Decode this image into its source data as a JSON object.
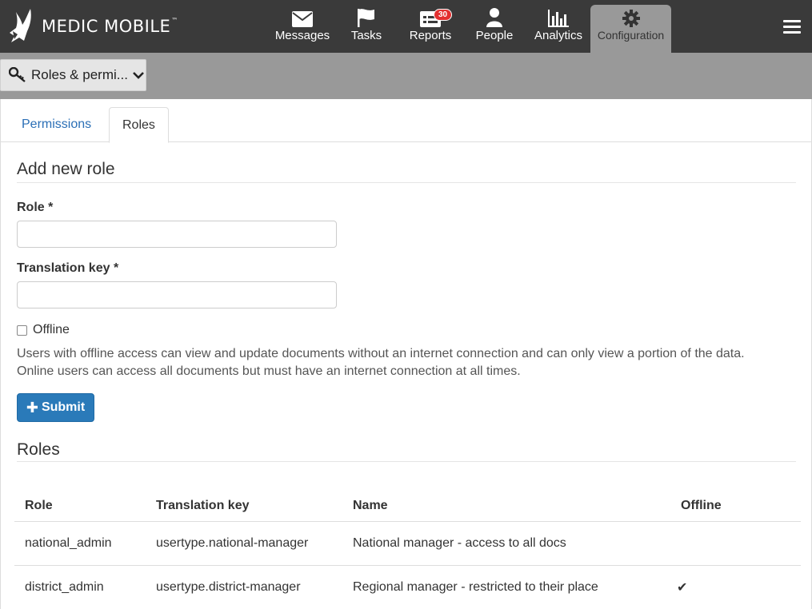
{
  "app": {
    "logo_text": "MEDIC MOBILE",
    "logo_tm": "™"
  },
  "nav": {
    "messages": "Messages",
    "tasks": "Tasks",
    "reports": "Reports",
    "reports_badge": "30",
    "people": "People",
    "analytics": "Analytics",
    "configuration": "Configuration"
  },
  "subbar": {
    "dropdown_label": "Roles & permi..."
  },
  "tabs": {
    "permissions": "Permissions",
    "roles": "Roles"
  },
  "form": {
    "title": "Add new role",
    "role_label": "Role *",
    "role_value": "",
    "translation_label": "Translation key *",
    "translation_value": "",
    "offline_label": "Offline",
    "offline_checked": false,
    "help_text_1": "Users with offline access can view and update documents without an internet connection and can only view a portion of the data.",
    "help_text_2": "Online users can access all documents but must have an internet connection at all times.",
    "submit_label": "Submit"
  },
  "roles_section": {
    "title": "Roles",
    "headers": [
      "Role",
      "Translation key",
      "Name",
      "Offline"
    ],
    "rows": [
      {
        "role": "national_admin",
        "key": "usertype.national-manager",
        "name": "National manager - access to all docs",
        "offline": ""
      },
      {
        "role": "district_admin",
        "key": "usertype.district-manager",
        "name": "Regional manager - restricted to their place",
        "offline": "✔"
      }
    ]
  },
  "colors": {
    "header_bg": "#3a3a3a",
    "subbar_bg": "#999999",
    "primary": "#2a7ab9",
    "badge": "#e33030",
    "link": "#2b6fb6"
  }
}
